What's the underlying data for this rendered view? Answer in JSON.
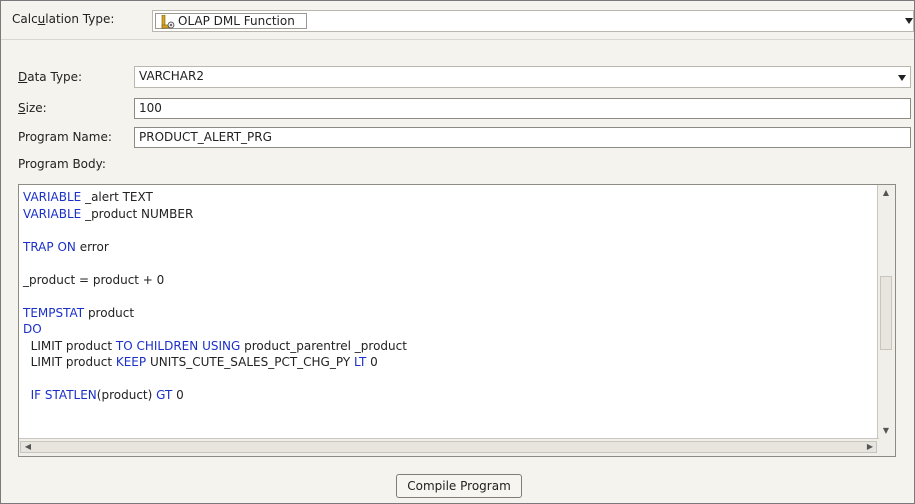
{
  "calculation_type": {
    "label_prefix": "Calc",
    "label_mnemonic": "u",
    "label_suffix": "lation Type:",
    "value": "OLAP DML Function",
    "icon": "olap-dml-function-icon"
  },
  "data_type": {
    "label_mnemonic": "D",
    "label_suffix": "ata Type:",
    "value": "VARCHAR2"
  },
  "size": {
    "label_mnemonic": "S",
    "label_suffix": "ize:",
    "value": "100"
  },
  "program_name": {
    "label": "Program Name:",
    "value": "PRODUCT_ALERT_PRG"
  },
  "program_body": {
    "label": "Program Body:",
    "lines": [
      [
        {
          "t": "VARIABLE",
          "kw": true
        },
        {
          "t": " _alert TEXT"
        }
      ],
      [
        {
          "t": "VARIABLE",
          "kw": true
        },
        {
          "t": " _product NUMBER"
        }
      ],
      [],
      [
        {
          "t": "TRAP",
          "kw": true
        },
        {
          "t": " "
        },
        {
          "t": "ON",
          "kw": true
        },
        {
          "t": " error"
        }
      ],
      [],
      [
        {
          "t": "_product = product + 0"
        }
      ],
      [],
      [
        {
          "t": "TEMPSTAT",
          "kw": true
        },
        {
          "t": " product"
        }
      ],
      [
        {
          "t": "DO",
          "kw": true
        }
      ],
      [
        {
          "t": "  LIMIT product "
        },
        {
          "t": "TO",
          "kw": true
        },
        {
          "t": " "
        },
        {
          "t": "CHILDREN",
          "kw": true
        },
        {
          "t": " "
        },
        {
          "t": "USING",
          "kw": true
        },
        {
          "t": " product_parentrel _product"
        }
      ],
      [
        {
          "t": "  LIMIT product "
        },
        {
          "t": "KEEP",
          "kw": true
        },
        {
          "t": " UNITS_CUTE_SALES_PCT_CHG_PY "
        },
        {
          "t": "LT",
          "kw": true
        },
        {
          "t": " 0"
        }
      ],
      [],
      [
        {
          "t": "  IF",
          "kw": true
        },
        {
          "t": " "
        },
        {
          "t": "STATLEN",
          "kw": true
        },
        {
          "t": "(product) "
        },
        {
          "t": "GT",
          "kw": true
        },
        {
          "t": " 0"
        }
      ]
    ]
  },
  "compile_button": "Compile Program",
  "colors": {
    "keyword": "#1b30c8",
    "panel_bg": "#f4f3ee"
  }
}
